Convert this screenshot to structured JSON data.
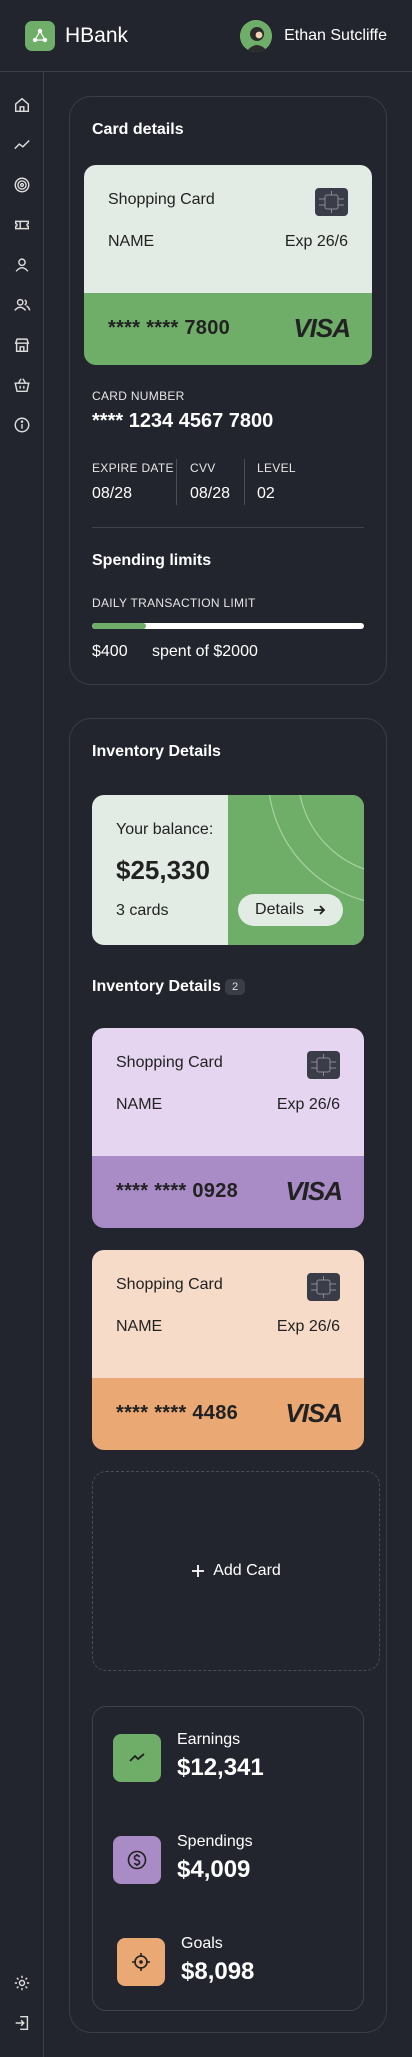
{
  "app": {
    "name": "HBank"
  },
  "user": {
    "name": "Ethan Sutcliffe"
  },
  "sidebar": {
    "icons": [
      "home-icon",
      "trend-icon",
      "target-icon",
      "ticket-icon",
      "user-icon",
      "users-icon",
      "store-icon",
      "basket-icon",
      "info-icon"
    ],
    "bottom_icons": [
      "settings-icon",
      "logout-icon"
    ]
  },
  "card_details": {
    "title": "Card details",
    "card": {
      "name": "Shopping Card",
      "holder": "NAME",
      "exp": "Exp 26/6",
      "number": "**** **** 7800",
      "brand": "VISA",
      "top_color": "#e3ebe5",
      "bottom_color": "#6fae69"
    },
    "card_number_label": "CARD NUMBER",
    "card_number": "**** 1234 4567 7800",
    "expire_label": "EXPIRE DATE",
    "expire_value": "08/28",
    "cvv_label": "CVV",
    "cvv_value": "08/28",
    "level_label": "LEVEL",
    "level_value": "02",
    "spending_title": "Spending limits",
    "daily_label": "DAILY TRANSACTION LIMIT",
    "spent": "$400",
    "spent_suffix": "spent of $2000",
    "spent_fraction": 0.2
  },
  "inventory": {
    "title": "Inventory Details",
    "balance_label": "Your balance:",
    "balance_value": "$25,330",
    "cards_count": "3 cards",
    "details_label": "Details",
    "list_title": "Inventory Details",
    "list_count": "2",
    "cards": [
      {
        "name": "Shopping Card",
        "holder": "NAME",
        "exp": "Exp 26/6",
        "number": "**** **** 0928",
        "brand": "VISA",
        "top_color": "#e5d5f1",
        "bottom_color": "#a98bc6"
      },
      {
        "name": "Shopping Card",
        "holder": "NAME",
        "exp": "Exp 26/6",
        "number": "**** **** 4486",
        "brand": "VISA",
        "top_color": "#f6dcc8",
        "bottom_color": "#e9a874"
      }
    ],
    "add_card_label": "Add Card"
  },
  "stats": [
    {
      "label": "Earnings",
      "value": "$12,341",
      "icon": "trend-icon",
      "color": "#6fae69"
    },
    {
      "label": "Spendings",
      "value": "$4,009",
      "icon": "dollar-icon",
      "color": "#a98bc6"
    },
    {
      "label": "Goals",
      "value": "$8,098",
      "icon": "crosshair-icon",
      "color": "#e9a874"
    }
  ]
}
